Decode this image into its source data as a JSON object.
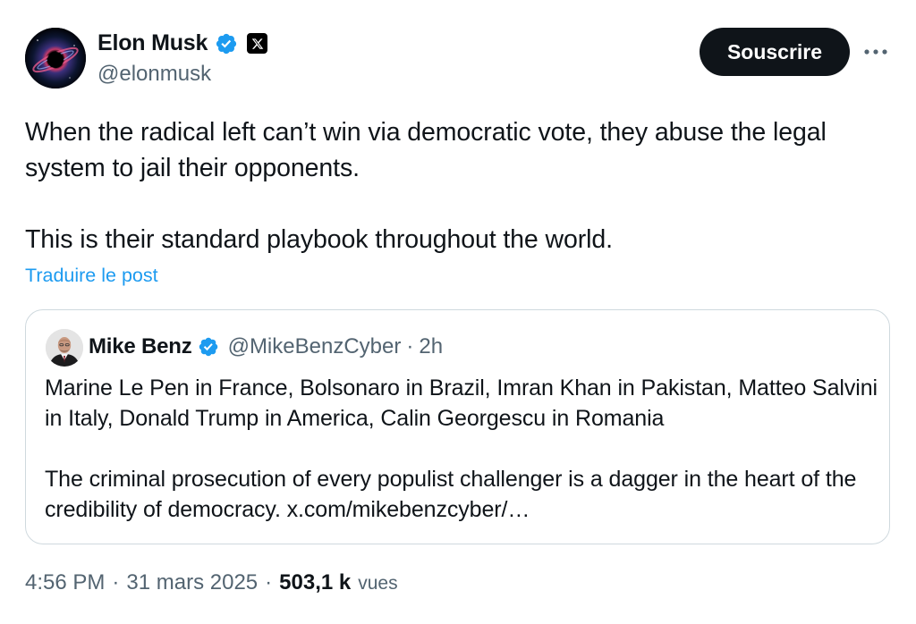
{
  "author": {
    "display_name": "Elon Musk",
    "handle": "@elonmusk",
    "verified_icon": "verified-badge-icon",
    "affiliate_icon": "x-logo-icon"
  },
  "actions": {
    "subscribe_label": "Souscrire",
    "more_icon": "more-horizontal-icon"
  },
  "post": {
    "text": "When the radical left can’t win via democratic vote, they abuse the legal system to jail their opponents.\n\nThis is their standard playbook throughout the world.",
    "translate_label": "Traduire le post"
  },
  "quote": {
    "display_name": "Mike Benz",
    "handle": "@MikeBenzCyber",
    "separator": "·",
    "time": "2h",
    "text": "Marine Le Pen in France, Bolsonaro in Brazil, Imran Khan in Pakistan, Matteo Salvini in Italy, Donald Trump in America, Calin Georgescu in Romania\n\nThe criminal prosecution of every populist challenger is a dagger in the heart of the credibility of democracy. x.com/mikebenzcyber/…"
  },
  "meta": {
    "time": "4:56 PM",
    "sep1": "·",
    "date": "31 mars 2025",
    "sep2": "·",
    "views_count": "503,1 k",
    "views_label": "vues"
  },
  "colors": {
    "text": "#0f1419",
    "secondary": "#536471",
    "link": "#1d9bf0",
    "verified": "#1d9bf0",
    "border": "#cfd9de",
    "button_bg": "#0f1419"
  }
}
